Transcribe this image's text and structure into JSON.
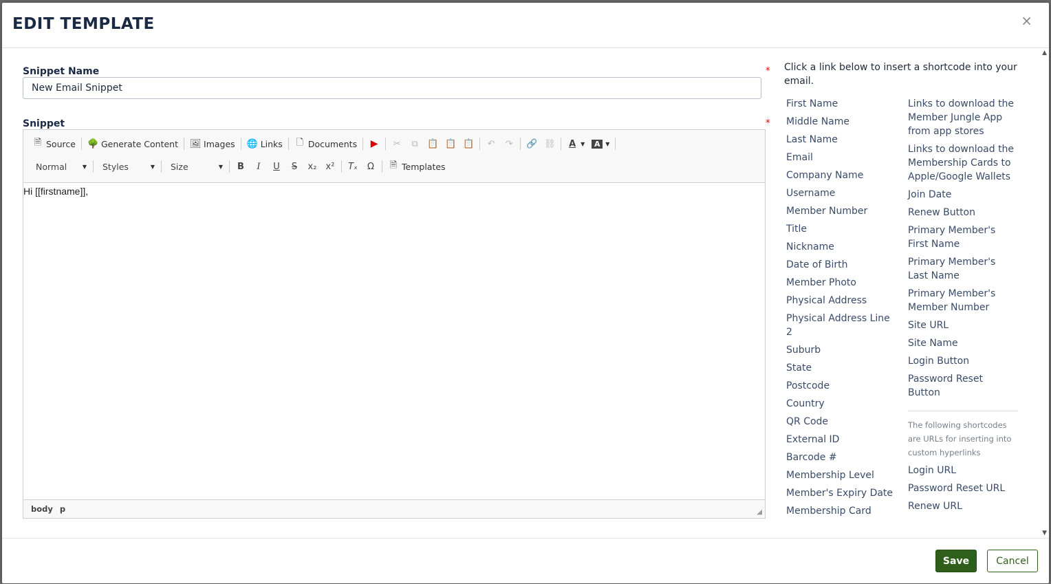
{
  "modal": {
    "title": "EDIT TEMPLATE",
    "close_glyph": "×"
  },
  "form": {
    "snippet_name_label": "Snippet Name",
    "snippet_name_value": "New Email Snippet",
    "snippet_label": "Snippet",
    "required_mark": "*"
  },
  "toolbar": {
    "row1": [
      {
        "icon": "source-icon",
        "glyph": "🗎",
        "label": "Source"
      },
      {
        "icon": "tree-icon",
        "glyph": "🌳",
        "label": "Generate Content"
      },
      {
        "icon": "image-icon",
        "glyph": "🖼",
        "label": "Images"
      },
      {
        "icon": "globe-icon",
        "glyph": "🌐",
        "label": "Links"
      },
      {
        "icon": "document-icon",
        "glyph": "🗋",
        "label": "Documents"
      }
    ],
    "format_value": "Normal",
    "styles_value": "Styles",
    "size_value": "Size",
    "templates_label": "Templates"
  },
  "editor": {
    "content": "Hi [[firstname]],",
    "path": [
      "body",
      "p"
    ]
  },
  "shortcodes": {
    "hint": "Click a link below to insert a shortcode into your email.",
    "left": [
      "First Name",
      "Middle Name",
      "Last Name",
      "Email",
      "Company Name",
      "Username",
      "Member Number",
      "Title",
      "Nickname",
      "Date of Birth",
      "Member Photo",
      "Physical Address",
      "Physical Address Line 2",
      "Suburb",
      "State",
      "Postcode",
      "Country",
      "QR Code",
      "External ID",
      "Barcode #",
      "Membership Level",
      "Member's Expiry Date",
      "Membership Card"
    ],
    "right": [
      "Links to download the Member Jungle App from app stores",
      "Links to download the Membership Cards to Apple/Google Wallets",
      "Join Date",
      "Renew Button",
      "Primary Member's First Name",
      "Primary Member's Last Name",
      "Primary Member's Member Number",
      "Site URL",
      "Site Name",
      "Login Button",
      "Password Reset Button"
    ],
    "url_note": "The following shortcodes are URLs for inserting into custom hyperlinks",
    "url_links": [
      "Login URL",
      "Password Reset URL",
      "Renew URL"
    ]
  },
  "footer": {
    "save_label": "Save",
    "cancel_label": "Cancel"
  },
  "colors": {
    "brand_green": "#2f5f1b",
    "link": "#3a4b68",
    "required": "#dd0000"
  }
}
